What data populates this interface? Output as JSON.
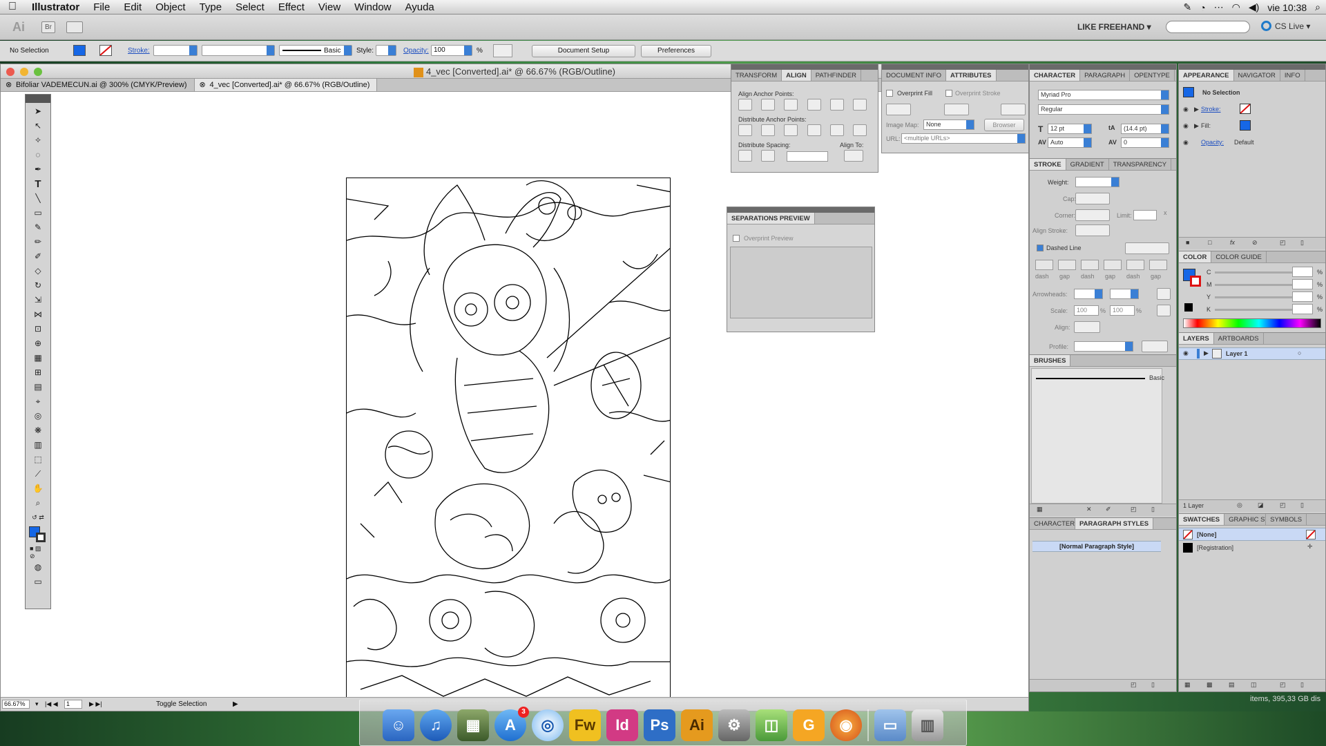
{
  "menubar": {
    "app": "Illustrator",
    "items": [
      "File",
      "Edit",
      "Object",
      "Type",
      "Select",
      "Effect",
      "View",
      "Window",
      "Ayuda"
    ],
    "clock": "vie 10:38"
  },
  "appbar": {
    "logo": "Ai",
    "bridge": "Br",
    "workspace": "LIKE FREEHAND ▾",
    "cs_live": "CS Live ▾"
  },
  "control": {
    "selection": "No Selection",
    "stroke_label": "Stroke:",
    "brush": "Basic",
    "style_label": "Style:",
    "opacity_label": "Opacity:",
    "opacity_value": "100",
    "percent": "%",
    "doc_setup": "Document Setup",
    "preferences": "Preferences"
  },
  "document": {
    "title": "4_vec [Converted].ai* @ 66.67% (RGB/Outline)",
    "tabs": [
      {
        "label": "Bifoliar VADEMECUN.ai @ 300% (CMYK/Preview)"
      },
      {
        "label": "4_vec [Converted].ai* @ 66.67% (RGB/Outline)"
      }
    ],
    "zoom": "66.67%",
    "page": "1",
    "status": "Toggle Selection"
  },
  "align_panel": {
    "tabs": [
      "TRANSFORM",
      "ALIGN",
      "PATHFINDER"
    ],
    "anchor_points": "Align Anchor Points:",
    "distribute_anchor": "Distribute Anchor Points:",
    "distribute_spacing": "Distribute Spacing:",
    "align_to": "Align To:"
  },
  "docinfo_panel": {
    "tabs": [
      "DOCUMENT INFO",
      "ATTRIBUTES"
    ],
    "overprint_fill": "Overprint Fill",
    "overprint_stroke": "Overprint Stroke",
    "image_map_label": "Image Map:",
    "image_map_value": "None",
    "browser": "Browser",
    "url_label": "URL:",
    "url_value": "<multiple URLs>"
  },
  "separations_panel": {
    "title": "SEPARATIONS PREVIEW",
    "overprint_preview": "Overprint Preview"
  },
  "character_panel": {
    "tabs": [
      "CHARACTER",
      "PARAGRAPH",
      "OPENTYPE"
    ],
    "font": "Myriad Pro",
    "style": "Regular",
    "size": "12 pt",
    "leading": "(14.4 pt)",
    "kerning": "Auto",
    "tracking": "0"
  },
  "stroke_panel": {
    "tabs": [
      "STROKE",
      "GRADIENT",
      "TRANSPARENCY"
    ],
    "weight": "Weight:",
    "cap": "Cap:",
    "corner": "Corner:",
    "limit": "Limit:",
    "limit_x": "x",
    "align_stroke": "Align Stroke:",
    "dashed_line": "Dashed Line",
    "dash_labels": [
      "dash",
      "gap",
      "dash",
      "gap",
      "dash",
      "gap"
    ],
    "arrowheads": "Arrowheads:",
    "scale": "Scale:",
    "scale_a": "100",
    "scale_b": "100",
    "percent": "%",
    "align": "Align:",
    "profile": "Profile:"
  },
  "brushes_panel": {
    "title": "BRUSHES",
    "brush_name": "Basic"
  },
  "parastyles_panel": {
    "tabs": [
      "CHARACTER STYLES",
      "PARAGRAPH STYLES"
    ],
    "item": "[Normal Paragraph Style]"
  },
  "appearance_panel": {
    "tabs": [
      "APPEARANCE",
      "NAVIGATOR",
      "INFO"
    ],
    "selection": "No Selection",
    "stroke": "Stroke:",
    "fill": "Fill:",
    "opacity": "Opacity:",
    "opacity_value": "Default"
  },
  "color_panel": {
    "tabs": [
      "COLOR",
      "COLOR GUIDE"
    ],
    "channels": [
      "C",
      "M",
      "Y",
      "K"
    ],
    "percent": "%"
  },
  "layers_panel": {
    "tabs": [
      "LAYERS",
      "ARTBOARDS"
    ],
    "layer": "Layer 1",
    "count": "1 Layer"
  },
  "swatches_panel": {
    "tabs": [
      "SWATCHES",
      "GRAPHIC STYLES",
      "SYMBOLS"
    ],
    "items": [
      "[None]",
      "[Registration]"
    ]
  },
  "finder_status": "items, 395,33 GB dis",
  "dock": {
    "apps": [
      {
        "label": "",
        "color": "#3b7fd8"
      },
      {
        "label": "♫",
        "color": "#2a6fc9"
      },
      {
        "label": "▦",
        "color": "#4a6a3a"
      },
      {
        "label": "A",
        "color": "#3a8ae0"
      },
      {
        "label": "◎",
        "color": "#5ca3e6"
      },
      {
        "label": "Fw",
        "color": "#e8b81a"
      },
      {
        "label": "Id",
        "color": "#c9367a"
      },
      {
        "label": "Ps",
        "color": "#2b6fc0"
      },
      {
        "label": "Ai",
        "color": "#e0911a"
      },
      {
        "label": "⚙",
        "color": "#8a8a8a"
      },
      {
        "label": "◫",
        "color": "#7ac25a"
      },
      {
        "label": "G",
        "color": "#f0a020"
      },
      {
        "label": "◉",
        "color": "#e06a1a"
      },
      {
        "label": "▭",
        "color": "#6a9ad0"
      },
      {
        "label": "▥",
        "color": "#b8b8b8"
      }
    ],
    "badge": "3"
  }
}
